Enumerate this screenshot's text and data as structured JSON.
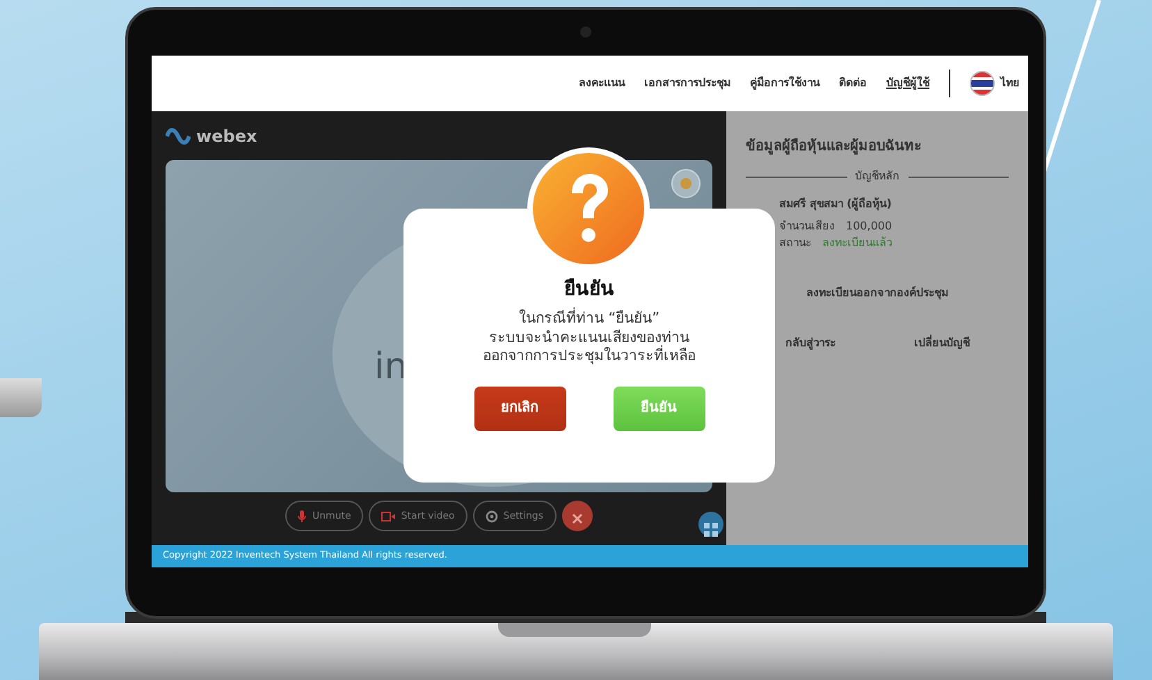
{
  "nav": {
    "items": [
      {
        "label": "ลงคะแนน",
        "selected": false
      },
      {
        "label": "เอกสารการประชุม",
        "selected": false
      },
      {
        "label": "คู่มือการใช้งาน",
        "selected": false
      },
      {
        "label": "ติดต่อ",
        "selected": false
      },
      {
        "label": "บัญชีผู้ใช้",
        "selected": true
      }
    ],
    "language": "ไทย"
  },
  "meeting": {
    "logo": "webex",
    "tile_text": "in",
    "controls": [
      {
        "kind": "mic",
        "label": "Unmute"
      },
      {
        "kind": "video",
        "label": "Start video"
      },
      {
        "kind": "settings",
        "label": "Settings"
      },
      {
        "kind": "leave"
      }
    ]
  },
  "panel": {
    "title": "ข้อมูลผู้ถือหุ้นและผู้มอบฉันทะ",
    "section": "บัญชีหลัก",
    "holder": "สมศรี สุขสมา (ผู้ถือหุ้น)",
    "votes_label": "จำนวนเสียง",
    "votes": "100,000",
    "status_label": "สถานะ",
    "status": "ลงทะเบียนแล้ว",
    "leave_link": "ลงทะเบียนออกจากองค์ประชุม",
    "links": [
      "กลับสู่วาระ",
      "เปลี่ยนบัญชี"
    ]
  },
  "dialog": {
    "title": "ยืนยัน",
    "message": [
      "ในกรณีที่ท่าน “ยืนยัน”",
      "ระบบจะนำคะแนนเสียงของท่าน",
      "ออกจากการประชุมในวาระที่เหลือ"
    ],
    "cancel": "ยกเลิก",
    "confirm": "ยืนยัน"
  },
  "footer": "Copyright  2022 Inventech System Thailand All rights reserved."
}
